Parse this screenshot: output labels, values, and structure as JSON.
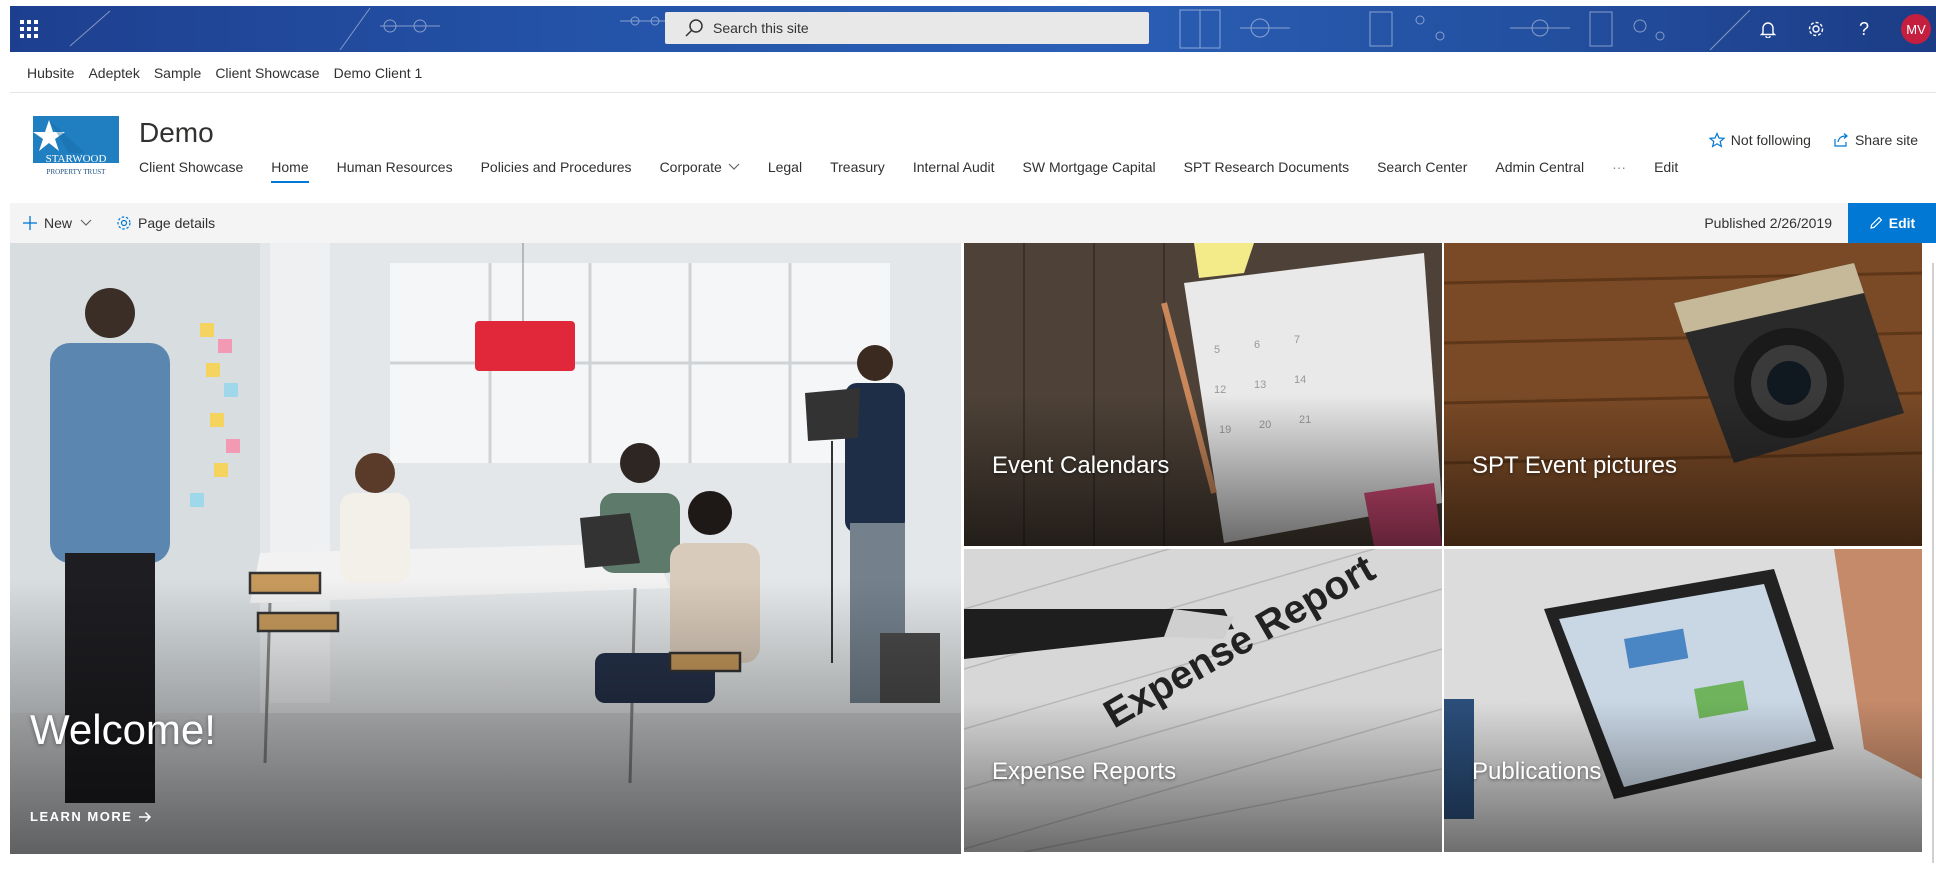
{
  "suitebar": {
    "search_placeholder": "Search this site",
    "user_initials": "MV"
  },
  "hubnav": [
    "Hubsite",
    "Adeptek",
    "Sample",
    "Client Showcase",
    "Demo Client 1"
  ],
  "site": {
    "title": "Demo",
    "nav": [
      {
        "label": "Client Showcase",
        "active": false
      },
      {
        "label": "Home",
        "active": true
      },
      {
        "label": "Human Resources",
        "active": false
      },
      {
        "label": "Policies and Procedures",
        "active": false
      },
      {
        "label": "Corporate",
        "active": false,
        "dropdown": true
      },
      {
        "label": "Legal",
        "active": false
      },
      {
        "label": "Treasury",
        "active": false
      },
      {
        "label": "Internal Audit",
        "active": false
      },
      {
        "label": "SW Mortgage Capital",
        "active": false
      },
      {
        "label": "SPT Research Documents",
        "active": false
      },
      {
        "label": "Search Center",
        "active": false
      },
      {
        "label": "Admin Central",
        "active": false
      },
      {
        "label": "···",
        "active": false
      },
      {
        "label": "Edit",
        "active": false
      }
    ],
    "not_following": "Not following",
    "share_site": "Share site",
    "logo_text": "STARWOOD",
    "logo_subtext": "PROPERTY TRUST"
  },
  "cmdbar": {
    "new_label": "New",
    "page_details_label": "Page details",
    "published": "Published 2/26/2019",
    "edit_label": "Edit"
  },
  "hero": {
    "main_title": "Welcome!",
    "learn_more": "LEARN MORE",
    "tiles": [
      {
        "title": "Event Calendars"
      },
      {
        "title": "SPT Event pictures"
      },
      {
        "title": "Expense Reports"
      },
      {
        "title": "Publications"
      }
    ]
  },
  "colors": {
    "accent": "#0078d4",
    "suitebar": "#2453a8",
    "avatar": "#c41f3e"
  }
}
